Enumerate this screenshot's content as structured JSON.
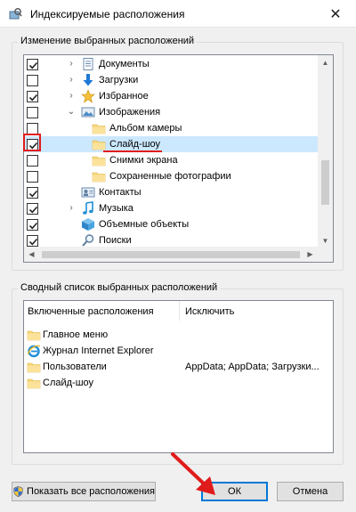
{
  "window": {
    "title": "Индексируемые расположения",
    "close_symbol": "✕"
  },
  "locations_group": {
    "legend": "Изменение выбранных расположений",
    "items": [
      {
        "label": "Документы",
        "checked": true,
        "expander": "›",
        "icon": "documents-icon"
      },
      {
        "label": "Загрузки",
        "checked": false,
        "expander": "›",
        "icon": "downloads-icon"
      },
      {
        "label": "Избранное",
        "checked": true,
        "expander": "›",
        "icon": "favorites-star-icon"
      },
      {
        "label": "Изображения",
        "checked": false,
        "expander": "⌄",
        "icon": "pictures-icon"
      },
      {
        "label": "Альбом камеры",
        "checked": false,
        "icon": "folder-icon"
      },
      {
        "label": "Слайд-шоу",
        "checked": true,
        "selected": true,
        "icon": "folder-icon"
      },
      {
        "label": "Снимки экрана",
        "checked": false,
        "icon": "folder-icon"
      },
      {
        "label": "Сохраненные фотографии",
        "checked": false,
        "icon": "folder-icon"
      },
      {
        "label": "Контакты",
        "checked": true,
        "icon": "contacts-icon"
      },
      {
        "label": "Музыка",
        "checked": true,
        "expander": "›",
        "icon": "music-icon"
      },
      {
        "label": "Объемные объекты",
        "checked": true,
        "icon": "3d-objects-icon"
      },
      {
        "label": "Поиски",
        "checked": true,
        "icon": "searches-icon"
      }
    ]
  },
  "summary_group": {
    "legend": "Сводный список выбранных расположений",
    "col_included": "Включенные расположения",
    "col_exclude": "Исключить",
    "rows": [
      {
        "name": "Главное меню",
        "exclude": "",
        "icon": "folder-icon"
      },
      {
        "name": "Журнал Internet Explorer",
        "exclude": "",
        "icon": "internet-explorer-icon"
      },
      {
        "name": "Пользователи",
        "exclude": "AppData; AppData; Загрузки...",
        "icon": "folder-icon"
      },
      {
        "name": "Слайд-шоу",
        "exclude": "",
        "icon": "folder-icon"
      }
    ]
  },
  "buttons": {
    "show_all": "Показать все расположения",
    "ok": "ОК",
    "cancel": "Отмена"
  },
  "colors": {
    "selection": "#cce8ff",
    "annotation_red": "#e01b1b",
    "folder_yellow": "#f8d775",
    "accent_blue": "#0078d7"
  }
}
